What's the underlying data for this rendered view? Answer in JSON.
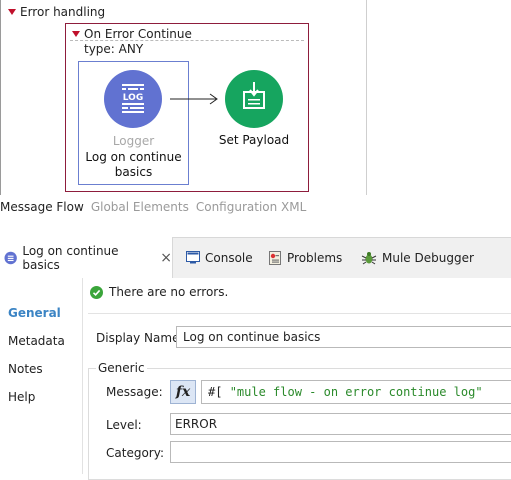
{
  "canvas": {
    "error_handling_label": "Error handling",
    "scope": {
      "title": "On Error Continue",
      "type_label": "type: ANY"
    },
    "logger": {
      "icon_text": "LOG",
      "component_type": "Logger",
      "name": "Log on continue basics",
      "color": "#6172d1"
    },
    "set_payload": {
      "name": "Set Payload",
      "color": "#16a55f"
    }
  },
  "view_tabs": {
    "message_flow": "Message Flow",
    "global_elements": "Global Elements",
    "configuration_xml": "Configuration XML"
  },
  "panel_tabs": {
    "active_tab": "Log on continue basics",
    "close_icon": "×",
    "console": "Console",
    "problems": "Problems",
    "mule_debugger": "Mule Debugger"
  },
  "nav": {
    "items": [
      "General",
      "Metadata",
      "Notes",
      "Help"
    ],
    "active": "General",
    "active_color": "#3b84c4"
  },
  "properties": {
    "status_text": "There are no errors.",
    "display_name_label": "Display Name:",
    "display_name_value": "Log on continue basics",
    "generic_label": "Generic",
    "message_label": "Message:",
    "fx_label": "fx",
    "message_prefix": "#[ ",
    "message_string": "\"mule flow - on error continue log\"",
    "level_label": "Level:",
    "level_value": "ERROR",
    "category_label": "Category:",
    "category_value": ""
  }
}
